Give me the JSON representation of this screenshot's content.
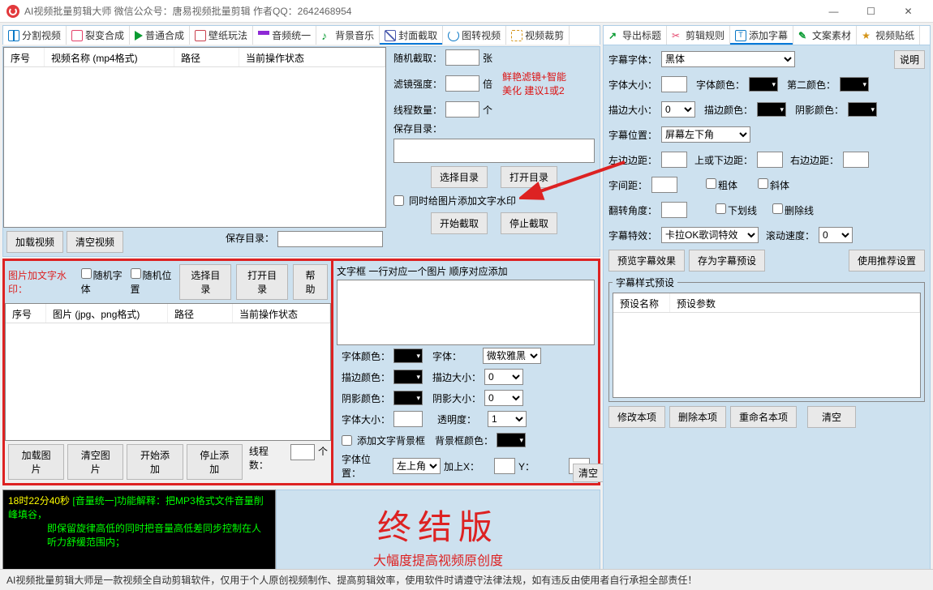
{
  "title": "AI视频批量剪辑大师   微信公众号：唐易视频批量剪辑   作者QQ：2642468954",
  "tabs_left": [
    "分割视频",
    "裂变合成",
    "普通合成",
    "壁纸玩法",
    "音频统一",
    "背景音乐",
    "封面截取",
    "图转视频",
    "视频裁剪"
  ],
  "tabs_right": [
    "导出标题",
    "剪辑规则",
    "添加字幕",
    "文案素材",
    "视频贴纸"
  ],
  "grid_video_cols": {
    "c1": "序号",
    "c2": "视频名称 (mp4格式)",
    "c3": "路径",
    "c4": "当前操作状态"
  },
  "btns": {
    "load_video": "加载视频",
    "clear_video": "清空视频",
    "save_dir": "保存目录："
  },
  "cover": {
    "rand": "随机截取：",
    "rand_unit": "张",
    "filter": "滤镜强度：",
    "filter_unit": "倍",
    "filter_hint1": "鲜艳滤镜+智能",
    "filter_hint2": "美化 建议1或2",
    "threads": "线程数量：",
    "threads_unit": "个",
    "savedir": "保存目录：",
    "choose_dir": "选择目录",
    "open_dir": "打开目录",
    "add_wm": "同时给图片添加文字水印",
    "start": "开始截取",
    "stop": "停止截取"
  },
  "wm": {
    "title": "图片加文字水印：",
    "rand_font": "随机字体",
    "rand_pos": "随机位置",
    "choose": "选择目录",
    "open": "打开目录",
    "help": "帮助",
    "grid": {
      "c1": "序号",
      "c2": "图片 (jpg、png格式)",
      "c3": "路径",
      "c4": "当前操作状态"
    },
    "load_img": "加载图片",
    "clear_img": "清空图片",
    "start_add": "开始添加",
    "stop_add": "停止添加",
    "threads": "线程数：",
    "unit": "个",
    "textline": "文字框 一行对应一个图片 顺序对应添加",
    "font_color": "字体颜色：",
    "font": "字体：",
    "font_val": "微软雅黑",
    "stroke_color": "描边颜色：",
    "stroke_size": "描边大小：",
    "shadow_color": "阴影颜色：",
    "shadow_size": "阴影大小：",
    "font_size": "字体大小：",
    "opacity": "透明度：",
    "add_bg": "添加文字背景框",
    "bg_color": "背景框颜色：",
    "pos": "字体位置：",
    "pos_val": "左上角",
    "plusx": "加上X：",
    "y": "Y："
  },
  "log": {
    "clear": "清空",
    "line1a": "18时22分40秒 ",
    "line1b": "[音量统一]功能解释：把MP3格式文件音量削峰填谷，",
    "line2": "即保留旋律高低的同时把音量高低差同步控制在人听力舒缓范围内；"
  },
  "ender": {
    "title": "终结版",
    "sub": "大幅度提高视频原创度"
  },
  "sub": {
    "explain": "说明",
    "font": "字幕字体：",
    "font_val": "黑体",
    "size": "字体大小：",
    "fcolor": "字体颜色：",
    "c2": "第二颜色：",
    "stroke": "描边大小：",
    "scolor": "描边颜色：",
    "shadow": "阴影颜色：",
    "pos": "字幕位置：",
    "pos_val": "屏幕左下角",
    "left": "左边边距：",
    "topbot": "上或下边距：",
    "right": "右边边距：",
    "spacing": "字间距：",
    "bold": "粗体",
    "italic": "斜体",
    "rotate": "翻转角度：",
    "underline": "下划线",
    "strike": "删除线",
    "fx": "字幕特效：",
    "fx_val": "卡拉OK歌词特效",
    "speed": "滚动速度：",
    "preview": "预览字幕效果",
    "save_preset": "存为字幕预设",
    "recommend": "使用推荐设置",
    "preset_legend": "字幕样式预设",
    "preset_c1": "预设名称",
    "preset_c2": "预设参数",
    "edit": "修改本项",
    "del": "删除本项",
    "rename": "重命名本项",
    "clear": "清空"
  },
  "footer": "AI视频批量剪辑大师是一款视频全自动剪辑软件，仅用于个人原创视频制作、提高剪辑效率，使用软件时请遵守法律法规，如有违反由使用者自行承担全部责任！"
}
